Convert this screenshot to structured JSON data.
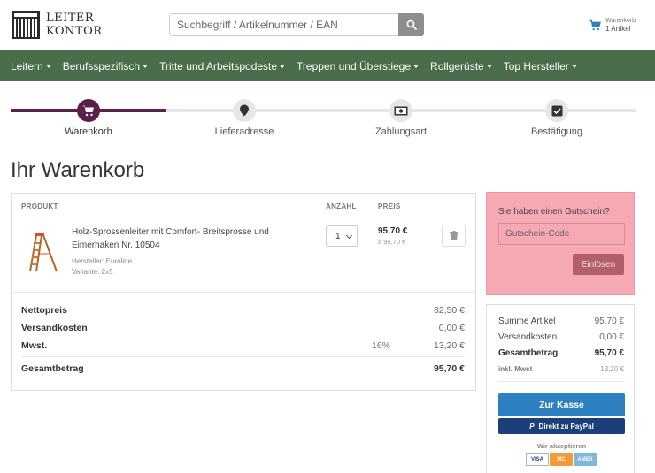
{
  "header": {
    "logo_line1": "LEITER",
    "logo_line2": "KONTOR",
    "search_placeholder": "Suchbegriff / Artikelnummer / EAN",
    "cart_label": "Warenkorb",
    "cart_count": "1 Artikel"
  },
  "nav": {
    "items": [
      {
        "label": "Leitern"
      },
      {
        "label": "Berufsspezifisch"
      },
      {
        "label": "Tritte und Arbeitspodeste"
      },
      {
        "label": "Treppen und Überstiege"
      },
      {
        "label": "Rollgerüste"
      },
      {
        "label": "Top Hersteller"
      }
    ]
  },
  "steps": [
    {
      "label": "Warenkorb",
      "icon": "cart-icon",
      "active": true
    },
    {
      "label": "Lieferadresse",
      "icon": "map-pin-icon",
      "active": false
    },
    {
      "label": "Zahlungsart",
      "icon": "money-icon",
      "active": false
    },
    {
      "label": "Bestätigung",
      "icon": "checkbox-icon",
      "active": false
    }
  ],
  "page_title": "Ihr Warenkorb",
  "cart": {
    "headers": {
      "product": "PRODUKT",
      "qty": "ANZAHL",
      "price": "PREIS"
    },
    "item": {
      "name": "Holz-Sprossenleiter mit Comfort- Breitsprosse und Eimerhaken Nr. 10504",
      "manufacturer": "Hersteller: Euroline",
      "variant": "Variante: 2x5",
      "quantity": "1",
      "price": "95,70 €",
      "unit_price": "à 95,70 €"
    },
    "totals": {
      "net_label": "Nettopreis",
      "net_value": "82,50 €",
      "shipping_label": "Versandkosten",
      "shipping_value": "0,00 €",
      "vat_label": "Mwst.",
      "vat_rate": "16%",
      "vat_value": "13,20 €",
      "total_label": "Gesamtbetrag",
      "total_value": "95,70 €"
    }
  },
  "voucher": {
    "question": "Sie haben einen Gutschein?",
    "placeholder": "Gutschein-Code",
    "button": "Einlösen"
  },
  "summary": {
    "items_label": "Summe Artikel",
    "items_value": "95,70 €",
    "shipping_label": "Versandkosten",
    "shipping_value": "0,00 €",
    "total_label": "Gesamtbetrag",
    "total_value": "95,70 €",
    "vat_label": "inkl. Mwst",
    "vat_value": "13,20 €",
    "checkout_button": "Zur Kasse",
    "paypal_button": "Direkt zu PayPal",
    "accept_label": "Wir akzeptieren",
    "cards": [
      "VISA",
      "MC",
      "AMEX"
    ]
  },
  "colors": {
    "nav_bg": "#4a6d4c",
    "step_active": "#5c1f4b",
    "voucher_bg": "#f6a9b3",
    "checkout_blue": "#2c7fc1",
    "paypal_navy": "#1a3f7a"
  }
}
